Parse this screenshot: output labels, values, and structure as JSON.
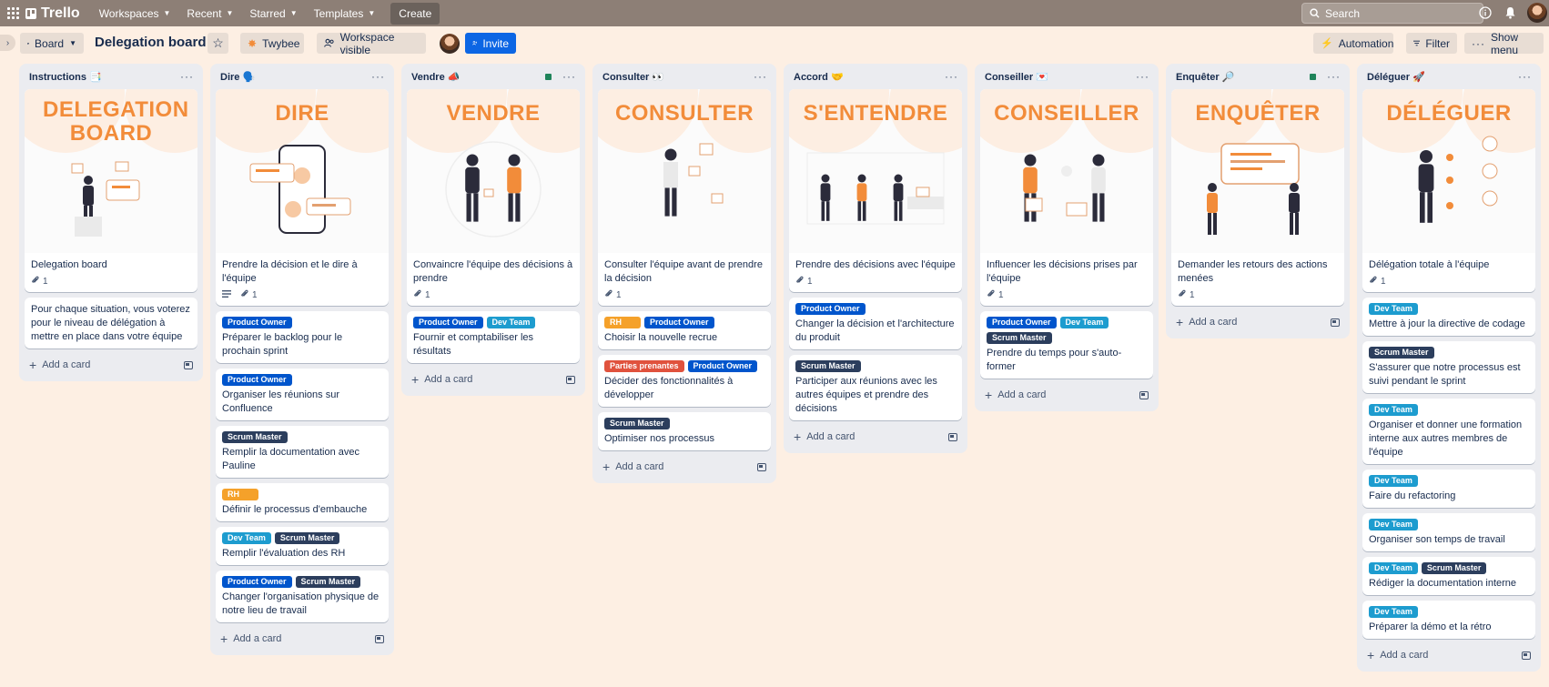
{
  "topnav": {
    "brand": "Trello",
    "menus": [
      "Workspaces",
      "Recent",
      "Starred",
      "Templates"
    ],
    "create_label": "Create",
    "search_placeholder": "Search"
  },
  "board": {
    "view_label": "Board",
    "title": "Delegation board",
    "workspace_name": "Twybee",
    "visibility_label": "Workspace visible",
    "invite_label": "Invite",
    "automation_label": "Automation",
    "filter_label": "Filter",
    "show_menu_label": "Show menu"
  },
  "add_card_label": "Add a card",
  "label_colors": {
    "Product Owner": "#0055cc",
    "Dev Team": "#1d9ccf",
    "Scrum Master": "#2c3e5d",
    "RH": "#f5a12a",
    "Parties prenantes": "#e0523d"
  },
  "lists": [
    {
      "title": "Instructions 📑",
      "has_dot": false,
      "cards": [
        {
          "cover": "DELEGATION BOARD",
          "illustration": "person-at-desk",
          "text": "Delegation board",
          "attachments": "1"
        },
        {
          "text": "Pour chaque situation, vous voterez pour le niveau de délégation à mettre en place dans votre équipe"
        }
      ]
    },
    {
      "title": "Dire 🗣️",
      "has_dot": false,
      "cards": [
        {
          "cover": "DIRE",
          "illustration": "phone-chat",
          "text": "Prendre la décision et le dire à l'équipe",
          "description": true,
          "attachments": "1"
        },
        {
          "labels": [
            "Product Owner"
          ],
          "text": "Préparer le backlog pour le prochain sprint"
        },
        {
          "labels": [
            "Product Owner"
          ],
          "text": "Organiser les réunions sur Confluence"
        },
        {
          "labels": [
            "Scrum Master"
          ],
          "text": "Remplir la documentation avec Pauline"
        },
        {
          "labels": [
            "RH"
          ],
          "text": "Définir le processus d'embauche"
        },
        {
          "labels": [
            "Dev Team",
            "Scrum Master"
          ],
          "text": "Remplir l'évaluation des RH"
        },
        {
          "labels": [
            "Product Owner",
            "Scrum Master"
          ],
          "text": "Changer l'organisation physique de notre lieu de travail"
        }
      ]
    },
    {
      "title": "Vendre 📣",
      "has_dot": true,
      "cards": [
        {
          "cover": "VENDRE",
          "illustration": "two-people-handshake",
          "text": "Convaincre l'équipe des décisions à prendre",
          "attachments": "1"
        },
        {
          "labels": [
            "Product Owner",
            "Dev Team"
          ],
          "text": "Fournir et comptabiliser les résultats"
        }
      ]
    },
    {
      "title": "Consulter 👀",
      "has_dot": false,
      "cards": [
        {
          "cover": "CONSULTER",
          "illustration": "person-leaning",
          "text": "Consulter l'équipe avant de prendre la décision",
          "attachments": "1"
        },
        {
          "labels": [
            "RH",
            "Product Owner"
          ],
          "text": "Choisir la nouvelle recrue"
        },
        {
          "labels": [
            "Parties prenantes",
            "Product Owner"
          ],
          "text": "Décider des fonctionnalités à développer"
        },
        {
          "labels": [
            "Scrum Master"
          ],
          "text": "Optimiser nos processus"
        }
      ]
    },
    {
      "title": "Accord 🤝",
      "has_dot": false,
      "cards": [
        {
          "cover": "S'ENTENDRE",
          "illustration": "three-people-table",
          "text": "Prendre des décisions avec l'équipe",
          "attachments": "1"
        },
        {
          "labels": [
            "Product Owner"
          ],
          "text": "Changer la décision et l'architecture du produit"
        },
        {
          "labels": [
            "Scrum Master"
          ],
          "text": "Participer aux réunions avec les autres équipes et prendre des décisions"
        }
      ]
    },
    {
      "title": "Conseiller 💌",
      "has_dot": false,
      "cards": [
        {
          "cover": "CONSEILLER",
          "illustration": "two-people-talking",
          "text": "Influencer les décisions prises par l'équipe",
          "attachments": "1"
        },
        {
          "labels": [
            "Product Owner",
            "Dev Team",
            "Scrum Master"
          ],
          "text": "Prendre du temps pour s'auto-former"
        }
      ]
    },
    {
      "title": "Enquêter 🔎",
      "has_dot": true,
      "cards": [
        {
          "cover": "ENQUÊTER",
          "illustration": "people-with-board",
          "text": "Demander les retours des actions menées",
          "attachments": "1"
        }
      ]
    },
    {
      "title": "Déléguer 🚀",
      "has_dot": false,
      "cards": [
        {
          "cover": "DÉLÉGUER",
          "illustration": "person-with-avatars",
          "text": "Délégation totale à l'équipe",
          "attachments": "1"
        },
        {
          "labels": [
            "Dev Team"
          ],
          "text": "Mettre à jour la directive de codage"
        },
        {
          "labels": [
            "Scrum Master"
          ],
          "text": "S'assurer que notre processus est suivi pendant le sprint"
        },
        {
          "labels": [
            "Dev Team"
          ],
          "text": "Organiser et donner une formation interne aux autres membres de l'équipe"
        },
        {
          "labels": [
            "Dev Team"
          ],
          "text": "Faire du refactoring"
        },
        {
          "labels": [
            "Dev Team"
          ],
          "text": "Organiser son temps de travail"
        },
        {
          "labels": [
            "Dev Team",
            "Scrum Master"
          ],
          "text": "Rédiger la documentation interne"
        },
        {
          "labels": [
            "Dev Team"
          ],
          "text": "Préparer la démo et la rétro"
        }
      ]
    }
  ]
}
